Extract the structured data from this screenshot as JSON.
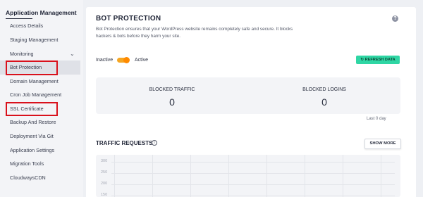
{
  "sidebar": {
    "title": "Application Management",
    "items": [
      {
        "label": "Access Details"
      },
      {
        "label": "Staging Management"
      },
      {
        "label": "Monitoring"
      },
      {
        "label": "Bot Protection"
      },
      {
        "label": "Domain Management"
      },
      {
        "label": "Cron Job Management"
      },
      {
        "label": "SSL Certificate"
      },
      {
        "label": "Backup And Restore"
      },
      {
        "label": "Deployment Via Git"
      },
      {
        "label": "Application Settings"
      },
      {
        "label": "Migration Tools"
      },
      {
        "label": "CloudwaysCDN"
      }
    ]
  },
  "main": {
    "title": "BOT PROTECTION",
    "description": "Bot Protection ensures that your WordPress website remains completely safe and secure. It blocks hackers & bots before they harm your site.",
    "toggle": {
      "inactive_label": "Inactive",
      "active_label": "Active",
      "state": "Active"
    },
    "refresh_label": "↻ REFRESH DATA",
    "stats": [
      {
        "label": "BLOCKED TRAFFIC",
        "value": "0"
      },
      {
        "label": "BLOCKED LOGINS",
        "value": "0"
      }
    ],
    "period": "Last 0 day",
    "traffic_title": "TRAFFIC REQUESTS",
    "show_more_label": "SHOW MORE",
    "chart_y_labels": [
      "300",
      "250",
      "200",
      "150"
    ]
  },
  "colors": {
    "accent_green": "#2fd6a4",
    "toggle_orange": "#ff8a00",
    "highlight_red": "#d9111c"
  }
}
